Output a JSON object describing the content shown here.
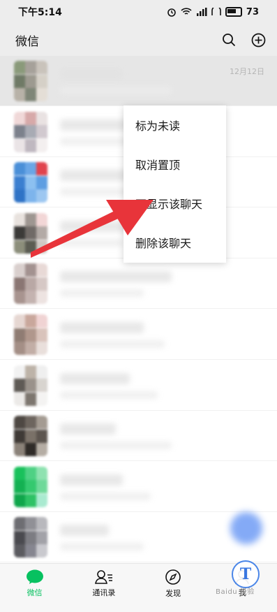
{
  "status_bar": {
    "time": "下午5:14",
    "signal_text": "ıl",
    "battery": "73"
  },
  "header": {
    "title": "微信"
  },
  "chat_list": {
    "pinned_time": "12月12日",
    "rows": [
      {
        "avatar": [
          "#8a9a7a",
          "#a6a19a",
          "#c9c3bb",
          "#6f7a66",
          "#9d9a90",
          "#d5d0c7",
          "#b8b2a8",
          "#7f8677",
          "#e4ded6"
        ]
      },
      {
        "avatar": [
          "#f0d8d8",
          "#d7a9a9",
          "#e9e2e2",
          "#7c818c",
          "#a8abb4",
          "#d1c9cf",
          "#eae4e6",
          "#bfb8c0",
          "#f3efef"
        ]
      },
      {
        "avatar": [
          "#4a8fd8",
          "#6aa6e6",
          "#e1434d",
          "#3b7fd0",
          "#8cc0f0",
          "#5e9ee2",
          "#2f73c6",
          "#7db4ec",
          "#9dc7f1"
        ]
      },
      {
        "avatar": [
          "#e8e2de",
          "#9e9691",
          "#f2d6d6",
          "#3b3a38",
          "#706a67",
          "#b3aaa6",
          "#8c8e7b",
          "#5b5c52",
          "#cfc8c3"
        ]
      },
      {
        "avatar": [
          "#d9cfcd",
          "#a39290",
          "#e8d9d6",
          "#8a7673",
          "#b9a8a5",
          "#d6c8c5",
          "#a8948f",
          "#c4b3b0",
          "#ede3e1"
        ]
      },
      {
        "avatar": [
          "#e6d7d2",
          "#c9a79c",
          "#f0d3d3",
          "#8f7c73",
          "#b0978c",
          "#d9c3bb",
          "#a48f86",
          "#c2aea6",
          "#e9dfdb"
        ]
      },
      {
        "avatar": [
          "#f2f2f2",
          "#bdb3a8",
          "#efefef",
          "#5f5a55",
          "#9a928b",
          "#d8d4cf",
          "#eceae8",
          "#7d766f",
          "#f4f3f2"
        ]
      },
      {
        "avatar": [
          "#4e4843",
          "#6d655e",
          "#a49b92",
          "#3f3a36",
          "#7a7168",
          "#5c554f",
          "#8b8279",
          "#2f2b28",
          "#b5ada4"
        ]
      },
      {
        "avatar": [
          "#19c15b",
          "#4ed184",
          "#8ee2b0",
          "#13b152",
          "#34c96f",
          "#6fd99a",
          "#0fa64b",
          "#2ec265",
          "#a9ead0"
        ]
      },
      {
        "avatar": [
          "#6d6d72",
          "#909096",
          "#b8b8bd",
          "#4a4a4f",
          "#7c7c82",
          "#a2a2a8",
          "#5b5b60",
          "#868690",
          "#c9c9ce"
        ]
      }
    ]
  },
  "context_menu": {
    "items": [
      "标为未读",
      "取消置顶",
      "不显示该聊天",
      "删除该聊天"
    ]
  },
  "bottom_nav": {
    "items": [
      {
        "label": "微信",
        "icon": "chat-bubble-icon",
        "active": true
      },
      {
        "label": "通讯录",
        "icon": "contacts-icon",
        "active": false
      },
      {
        "label": "发现",
        "icon": "compass-icon",
        "active": false
      },
      {
        "label": "我",
        "icon": "person-icon",
        "active": false
      }
    ]
  },
  "watermark": {
    "badge": "T",
    "text": "Baidu 经验"
  },
  "colors": {
    "accent": "#07c160",
    "arrow": "#e8343a"
  }
}
